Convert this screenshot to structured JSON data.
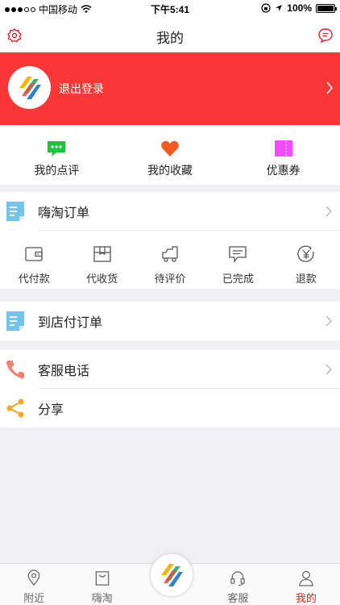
{
  "status_bar": {
    "carrier": "中国移动",
    "time": "下午5:41",
    "battery": "100%"
  },
  "nav": {
    "title": "我的"
  },
  "profile": {
    "logout_label": "退出登录"
  },
  "quick_actions": [
    {
      "label": "我的点评",
      "icon": "comment-icon"
    },
    {
      "label": "我的收藏",
      "icon": "heart-icon"
    },
    {
      "label": "优惠券",
      "icon": "coupon-icon"
    }
  ],
  "haitao_orders": {
    "label": "嗨淘订单",
    "statuses": [
      {
        "label": "代付款",
        "icon": "wallet-icon"
      },
      {
        "label": "代收货",
        "icon": "box-icon"
      },
      {
        "label": "待评价",
        "icon": "truck-icon"
      },
      {
        "label": "已完成",
        "icon": "message-icon"
      },
      {
        "label": "退款",
        "icon": "yen-icon"
      }
    ]
  },
  "store_orders": {
    "label": "到店付订单"
  },
  "customer_service": {
    "label": "客服电话"
  },
  "share": {
    "label": "分享"
  },
  "tab_bar": {
    "items": [
      {
        "label": "附近",
        "icon": "location-icon"
      },
      {
        "label": "嗨淘",
        "icon": "bag-icon"
      },
      {
        "label": "客服",
        "icon": "headset-icon"
      },
      {
        "label": "我的",
        "icon": "user-icon"
      }
    ],
    "active": "我的"
  },
  "colors": {
    "accent": "#fa3737",
    "active_tab": "#e0222a",
    "background": "#efeff4"
  }
}
